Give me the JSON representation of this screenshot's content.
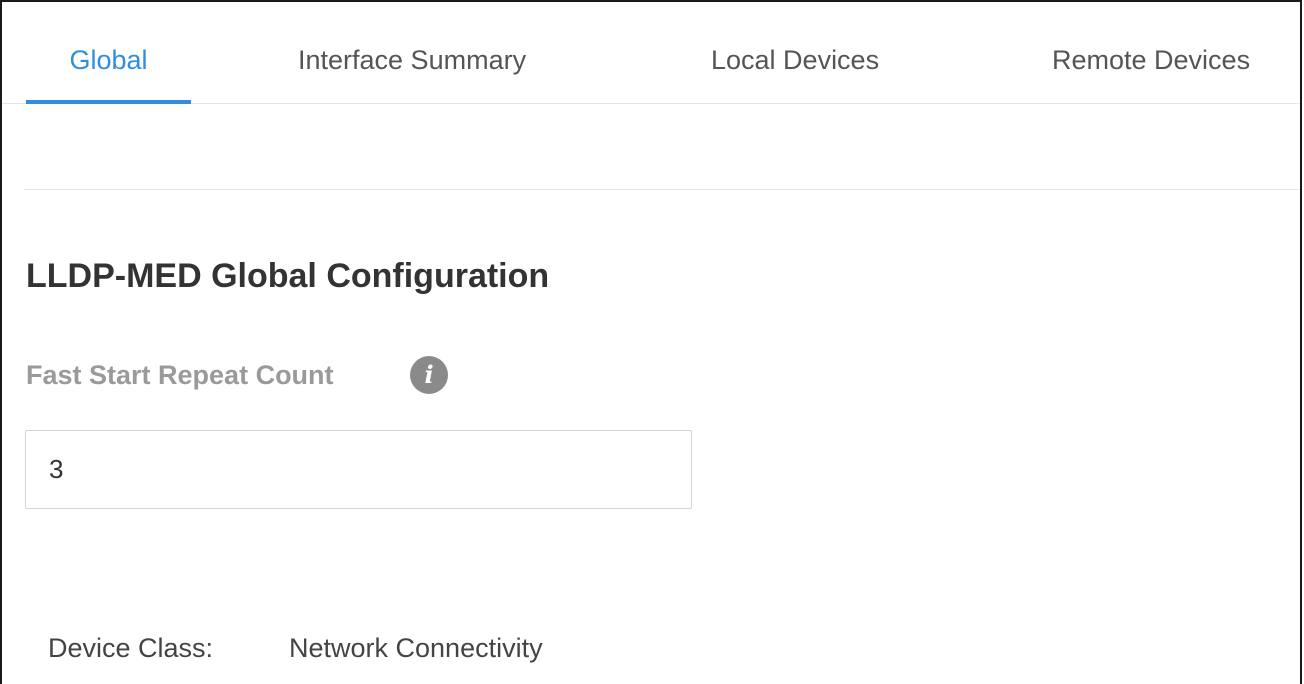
{
  "tabs": [
    {
      "label": "Global",
      "active": true
    },
    {
      "label": "Interface Summary",
      "active": false
    },
    {
      "label": "Local Devices",
      "active": false
    },
    {
      "label": "Remote Devices",
      "active": false
    }
  ],
  "section": {
    "title": "LLDP-MED Global Configuration"
  },
  "fast_start": {
    "label": "Fast Start Repeat Count",
    "info_icon": "info-icon",
    "value": "3"
  },
  "device_class": {
    "label": "Device Class:",
    "value": "Network Connectivity"
  },
  "colors": {
    "accent": "#2f8ee0",
    "label_muted": "#9a9a9a",
    "info_icon_bg": "#8a8a8a",
    "divider": "#e6e6e6"
  }
}
